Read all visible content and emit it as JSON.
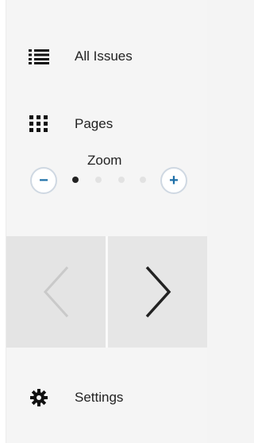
{
  "menu": {
    "all_issues_label": "All Issues",
    "pages_label": "Pages",
    "settings_label": "Settings"
  },
  "zoom": {
    "label": "Zoom",
    "minus_symbol": "−",
    "plus_symbol": "+",
    "levels": 4,
    "current_level": 1
  },
  "colors": {
    "accent": "#1d6fa8",
    "panel_bg": "#f5f5f5",
    "nav_bg": "#e4e4e4",
    "disabled_arrow": "#c9c9c9",
    "active_arrow": "#222222"
  },
  "icons": {
    "all_issues": "list-icon",
    "pages": "grid-icon",
    "settings": "gear-icon",
    "prev": "chevron-left-icon",
    "next": "chevron-right-icon"
  }
}
